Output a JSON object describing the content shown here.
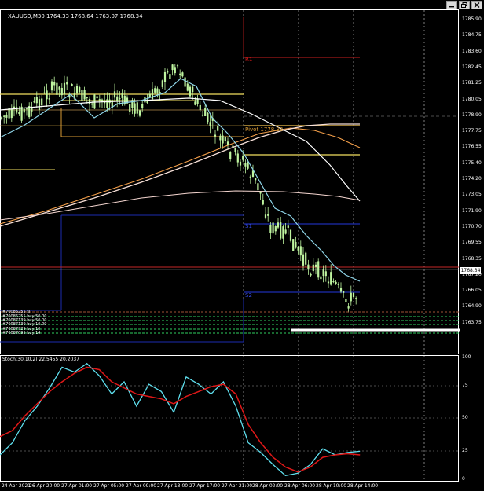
{
  "window": {
    "symbol_info": "XAUUSD,M30  1764.33 1768.64 1763.07 1768.34",
    "controls": [
      "minimize-icon",
      "restore-icon",
      "close-icon"
    ]
  },
  "price_axis": {
    "labels": [
      "1785.90",
      "1784.75",
      "1783.60",
      "1782.45",
      "1781.25",
      "1780.05",
      "1778.90",
      "1777.75",
      "1776.55",
      "1775.40",
      "1774.20",
      "1773.05",
      "1771.90",
      "1770.70",
      "1769.55",
      "1768.35",
      "1767.20",
      "1766.05",
      "1764.90",
      "1763.75"
    ],
    "current_price": "1768.34"
  },
  "pivots": {
    "r1": "R1",
    "pivot": "Pivot 1778.83",
    "s1": "S1",
    "s2": "S2"
  },
  "orders": [
    "#70086255 sl",
    "#70086255 buy 50.00",
    "#70087139 buy 50.00",
    "#70087139 buy 10.00",
    "#70087729 buy 10",
    "#70087095 buy 14"
  ],
  "stochastic": {
    "title": "Stoch(30,10,2) 22.5455 20.2037",
    "levels": [
      "100",
      "75",
      "50",
      "25",
      "0"
    ]
  },
  "time_axis": {
    "labels": [
      "24 Apr 2021",
      "26 Apr 20:00",
      "27 Apr 01:00",
      "27 Apr 05:00",
      "27 Apr 09:00",
      "27 Apr 13:00",
      "27 Apr 17:00",
      "27 Apr 21:00",
      "28 Apr 02:00",
      "28 Apr 06:00",
      "28 Apr 10:00",
      "28 Apr 14:00"
    ]
  },
  "colors": {
    "background": "#000000",
    "candle": "#bff5a0",
    "ma_fast": "#8fd5e8",
    "ma_slow_200": "#f7e0d8",
    "ma_mid_100": "#ffffff",
    "ma_orange": "#f5a04a",
    "pivot_line": "#c8a040",
    "r_line": "#a01818",
    "s_line": "#1c2cb0",
    "yellow_level": "#f2e060",
    "stoch_main": "#5fe0ef",
    "stoch_signal": "#e01818",
    "order_line": "#2fd060",
    "current_price_line": "#c62828"
  }
}
